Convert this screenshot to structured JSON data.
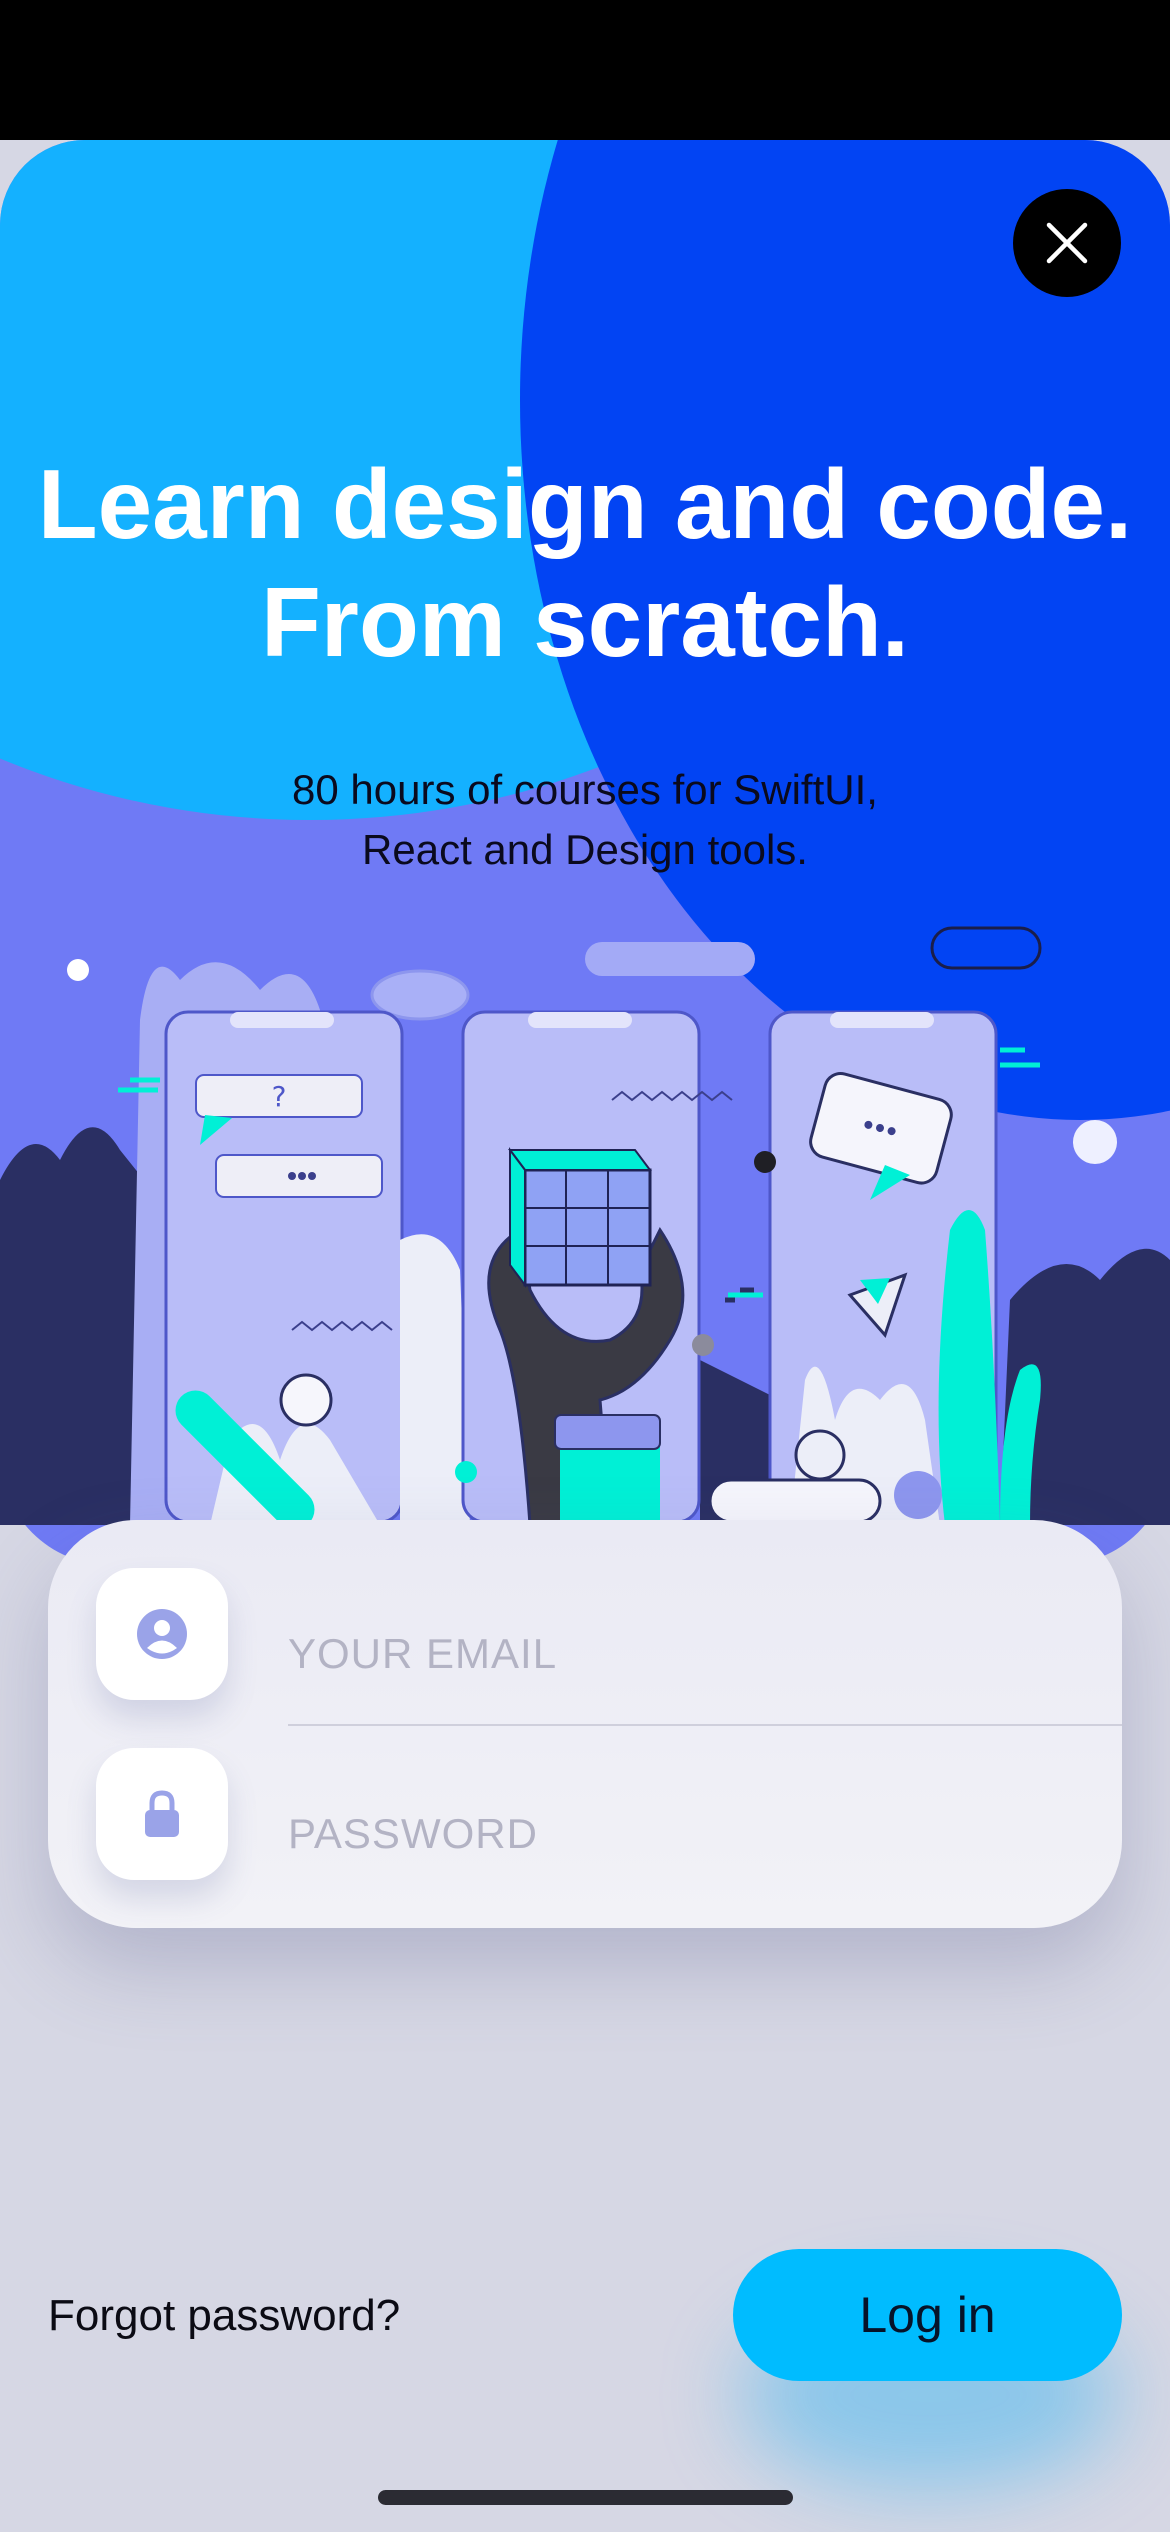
{
  "hero": {
    "headline_line1": "Learn design and code.",
    "headline_line2": "From scratch.",
    "subhead_line1": "80 hours of courses for SwiftUI,",
    "subhead_line2": "React and Design tools.",
    "illustration_question_mark": "?"
  },
  "close_button": {
    "icon": "close-icon"
  },
  "login_form": {
    "email_placeholder": "YOUR EMAIL",
    "password_placeholder": "PASSWORD",
    "email_icon": "person-icon",
    "password_icon": "lock-icon"
  },
  "footer": {
    "forgot_password_label": "Forgot password?",
    "login_label": "Log in"
  },
  "colors": {
    "accent": "#00bcff",
    "hero_light_blue": "#14b1ff",
    "hero_dark_blue": "#0244f3",
    "hero_violet": "#6f7af5",
    "background": "#d6d7e4"
  }
}
